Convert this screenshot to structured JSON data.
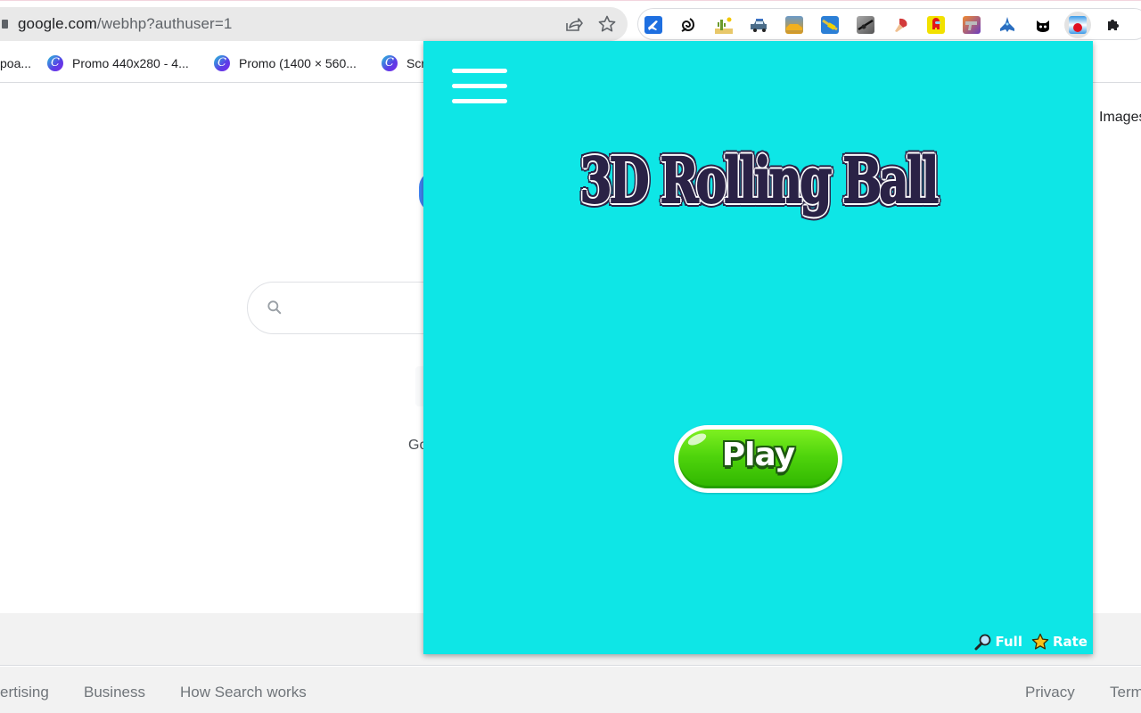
{
  "browser": {
    "url_host": "google.com",
    "url_path": "/webhp?authuser=1",
    "share_icon": "share-icon",
    "bookmark_icon": "star-icon",
    "extensions": [
      {
        "name": "airplane-extension-icon",
        "color": "#1e6fe0"
      },
      {
        "name": "swirl-leaf-extension-icon",
        "color": "#111111"
      },
      {
        "name": "desert-cactus-extension-icon",
        "color": "#d8b040"
      },
      {
        "name": "police-car-extension-icon",
        "color": "#4a6c88"
      },
      {
        "name": "racing-car-extension-icon",
        "color": "#d89a20"
      },
      {
        "name": "yellow-car-extension-icon",
        "color": "#2b7fd6"
      },
      {
        "name": "sniper-extension-icon",
        "color": "#555555"
      },
      {
        "name": "boxing-glove-extension-icon",
        "color": "#c83a3a"
      },
      {
        "name": "among-us-extension-icon",
        "color": "#f2e100"
      },
      {
        "name": "gun-extension-icon",
        "color": "#7a4bb0"
      },
      {
        "name": "spaceship-extension-icon",
        "color": "#2a6ec0"
      },
      {
        "name": "cat-extension-icon",
        "color": "#000000"
      },
      {
        "name": "rolling-ball-extension-icon",
        "color": "#2a8fe0"
      },
      {
        "name": "extensions-puzzle-icon",
        "color": "#202124"
      }
    ],
    "bookmarks": [
      {
        "label": "poa..."
      },
      {
        "label": "Promo 440x280 - 4..."
      },
      {
        "label": "Promo (1400 × 560..."
      },
      {
        "label": "Scr"
      }
    ]
  },
  "google_page": {
    "images_link": "Images",
    "offered_in_fragment": "Go",
    "footer_links_left": [
      "ertising",
      "Business",
      "How Search works"
    ],
    "footer_links_right": [
      "Privacy",
      "Term"
    ]
  },
  "popup": {
    "background_color": "#0ee6e6",
    "menu_icon": "hamburger-menu-icon",
    "game_title": "3D Rolling Ball",
    "play_label": "Play",
    "footer": {
      "full_label": "Full",
      "full_icon": "magnifier-icon",
      "rate_label": "Rate",
      "rate_icon": "star-icon"
    }
  }
}
